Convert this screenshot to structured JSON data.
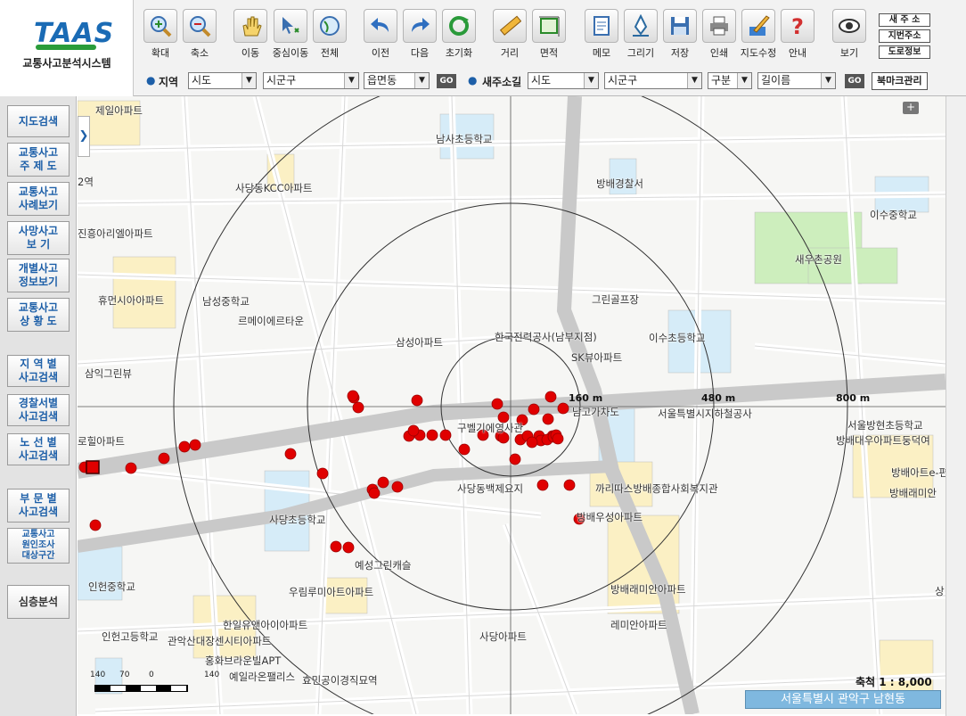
{
  "app": {
    "logo": "TAAS",
    "system_name": "교통사고분석시스템"
  },
  "toolbar": [
    {
      "key": "zoomin",
      "label": "확대",
      "icon": "zoom-in-icon"
    },
    {
      "key": "zoomout",
      "label": "축소",
      "icon": "zoom-out-icon"
    },
    {
      "key": "pan",
      "label": "이동",
      "icon": "hand-icon"
    },
    {
      "key": "center",
      "label": "중심이동",
      "icon": "center-move-icon"
    },
    {
      "key": "full",
      "label": "전체",
      "icon": "full-extent-icon"
    },
    {
      "key": "prev",
      "label": "이전",
      "icon": "back-arrow-icon"
    },
    {
      "key": "next",
      "label": "다음",
      "icon": "forward-arrow-icon"
    },
    {
      "key": "reset",
      "label": "초기화",
      "icon": "refresh-icon"
    },
    {
      "key": "distance",
      "label": "거리",
      "icon": "ruler-icon"
    },
    {
      "key": "area",
      "label": "면적",
      "icon": "area-icon"
    },
    {
      "key": "memo",
      "label": "메모",
      "icon": "memo-icon"
    },
    {
      "key": "draw",
      "label": "그리기",
      "icon": "pen-icon"
    },
    {
      "key": "save",
      "label": "저장",
      "icon": "floppy-icon"
    },
    {
      "key": "print",
      "label": "인쇄",
      "icon": "printer-icon"
    },
    {
      "key": "edit",
      "label": "지도수정",
      "icon": "brush-icon"
    },
    {
      "key": "guide",
      "label": "안내",
      "icon": "question-icon"
    },
    {
      "key": "view",
      "label": "보기",
      "icon": "eye-icon"
    }
  ],
  "address_buttons": [
    "새 주 소",
    "지번주소",
    "도로정보"
  ],
  "search": {
    "region_label": "지역",
    "region_sido": "시도",
    "region_sigungu": "시군구",
    "region_dong": "읍면동",
    "go": "GO",
    "newaddr_label": "새주소길",
    "new_sido": "시도",
    "new_sigungu": "시군구",
    "new_gubun": "구분",
    "new_road": "길이름",
    "bookmark": "북마크관리"
  },
  "sidebar": [
    {
      "label": "지도검색",
      "key": "map-search"
    },
    {
      "label": "교통사고\n주 제 도",
      "key": "theme-map"
    },
    {
      "label": "교통사고\n사례보기",
      "key": "case-view"
    },
    {
      "label": "사망사고\n보   기",
      "key": "fatal-view"
    },
    {
      "label": "개별사고\n정보보기",
      "key": "individual-info"
    },
    {
      "label": "교통사고\n상 황 도",
      "key": "situation-map"
    },
    {
      "label": "지 역 별\n사고검색",
      "key": "region-search"
    },
    {
      "label": "경찰서별\n사고검색",
      "key": "police-search"
    },
    {
      "label": "노 선 별\n사고검색",
      "key": "route-search"
    },
    {
      "label": "부 문 별\n사고검색",
      "key": "sector-search"
    },
    {
      "label": "교통사고\n원인조사\n대상구간",
      "key": "cause-survey"
    },
    {
      "label": "심층분석",
      "key": "deep-analysis"
    }
  ],
  "map": {
    "pois": [
      {
        "text": "제일아파트",
        "pos": "a"
      },
      {
        "text": "남사초등학교",
        "pos": "b"
      },
      {
        "text": "사당동KCC아파트",
        "pos": "c"
      },
      {
        "text": "방배경찰서",
        "pos": "d"
      },
      {
        "text": "이수중학교",
        "pos": "e"
      },
      {
        "text": "새우촌공원",
        "pos": "f"
      },
      {
        "text": "진흥아리엘아파트",
        "pos": "g"
      },
      {
        "text": "휴먼시아아파트",
        "pos": "h"
      },
      {
        "text": "남성중학교",
        "pos": "i"
      },
      {
        "text": "르메이에르타운",
        "pos": "j"
      },
      {
        "text": "그린골프장",
        "pos": "k"
      },
      {
        "text": "한국전력공사(남부지점)",
        "pos": "l"
      },
      {
        "text": "삼성아파트",
        "pos": "m"
      },
      {
        "text": "이수초등학교",
        "pos": "n"
      },
      {
        "text": "SK뷰아파트",
        "pos": "o"
      },
      {
        "text": "삼익그린뷰",
        "pos": "p"
      },
      {
        "text": "구벨기에영사관",
        "pos": "q"
      },
      {
        "text": "남고가차도",
        "pos": "r"
      },
      {
        "text": "서울특별시지하철공사",
        "pos": "s"
      },
      {
        "text": "서울방현초등학교",
        "pos": "t"
      },
      {
        "text": "방배대우아파트둥덕여",
        "pos": "u"
      },
      {
        "text": "로힐아파트",
        "pos": "v"
      },
      {
        "text": "방배아트e-편",
        "pos": "w"
      },
      {
        "text": "사당동백제요지",
        "pos": "x"
      },
      {
        "text": "까리따스방배종합사회복지관",
        "pos": "y"
      },
      {
        "text": "방배래미안",
        "pos": "z"
      },
      {
        "text": "사당초등학교",
        "pos": "aa"
      },
      {
        "text": "방배우성아파트",
        "pos": "ab"
      },
      {
        "text": "예성그린캐슬",
        "pos": "ac"
      },
      {
        "text": "인헌중학교",
        "pos": "ad"
      },
      {
        "text": "우림루미아트아파트",
        "pos": "ae"
      },
      {
        "text": "방배래미안아파트",
        "pos": "af"
      },
      {
        "text": "한일유앤아이아파트",
        "pos": "ag"
      },
      {
        "text": "레미안아파트",
        "pos": "ah"
      },
      {
        "text": "인헌고등학교",
        "pos": "ai"
      },
      {
        "text": "관악산대장센시티아파트",
        "pos": "aj"
      },
      {
        "text": "사당아파트",
        "pos": "ak"
      },
      {
        "text": "홍화브라운빌APT",
        "pos": "al"
      },
      {
        "text": "예일라온팰리스",
        "pos": "am"
      },
      {
        "text": "효민공이경직묘역",
        "pos": "an"
      },
      {
        "text": "2역",
        "pos": "ao"
      },
      {
        "text": "상",
        "pos": "ap"
      }
    ],
    "distances": [
      "160 m",
      "480 m",
      "800 m"
    ],
    "scale_text": "축척  1 : 8,000",
    "scale_ticks": [
      "140",
      "70",
      "0",
      "140"
    ],
    "region_name": "서울특별시 관악구 남현동"
  },
  "colors": {
    "accident": "#e00000",
    "road": "#c9c9c9",
    "park": "#cdeebd",
    "school": "#d6ecf8",
    "apt": "#fbf0c4",
    "region_bar": "#7fb8df"
  }
}
